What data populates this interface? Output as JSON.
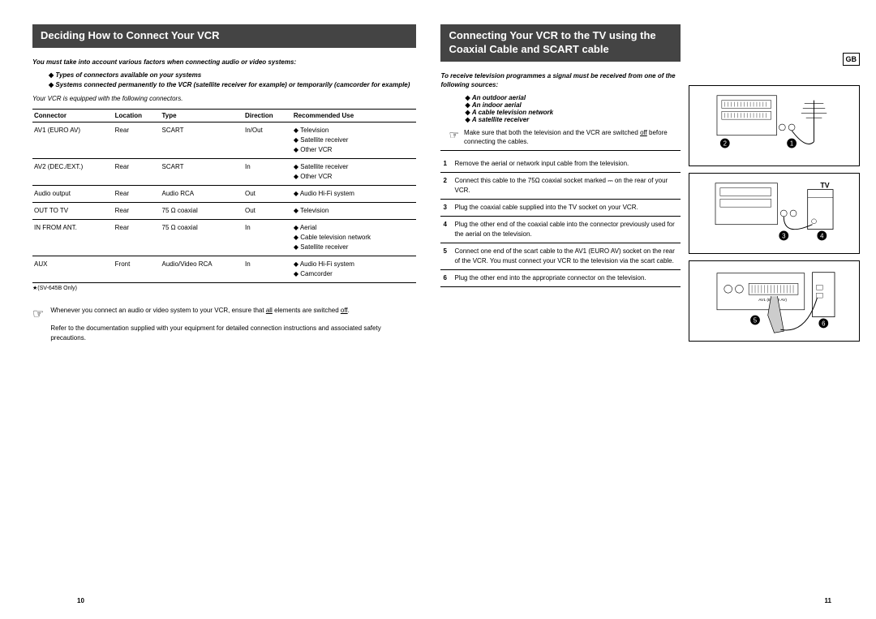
{
  "left": {
    "header": "Deciding How to Connect Your VCR",
    "intro": "You must take into account various factors when connecting audio or video systems:",
    "bullets": [
      "Types of connectors available on your systems",
      "Systems connected permanently to the VCR (satellite receiver for example) or temporarily (camcorder for example)"
    ],
    "subintro": "Your VCR is equipped with the following connectors.",
    "table": {
      "headers": [
        "Connector",
        "Location",
        "Type",
        "Direction",
        "Recommended Use"
      ],
      "rows": [
        {
          "connector": "AV1 (EURO AV)",
          "location": "Rear",
          "type": "SCART",
          "direction": "In/Out",
          "rec": [
            "Television",
            "Satellite receiver",
            "Other VCR"
          ]
        },
        {
          "connector": "AV2 (DEC./EXT.)",
          "location": "Rear",
          "type": "SCART",
          "direction": "In",
          "rec": [
            "Satellite receiver",
            "Other VCR"
          ]
        },
        {
          "connector": "Audio output",
          "location": "Rear",
          "type": "Audio RCA",
          "direction": "Out",
          "rec": [
            "Audio Hi-Fi system"
          ]
        },
        {
          "connector": "OUT TO TV",
          "location": "Rear",
          "type": "75 Ω coaxial",
          "direction": "Out",
          "rec": [
            "Television"
          ]
        },
        {
          "connector": "IN FROM ANT.",
          "location": "Rear",
          "type": "75 Ω coaxial",
          "direction": "In",
          "rec": [
            "Aerial",
            "Cable television network",
            "Satellite receiver"
          ]
        },
        {
          "connector": "AUX",
          "location": "Front",
          "type": "Audio/Video RCA",
          "direction": "In",
          "rec": [
            "Audio Hi-Fi system",
            "Camcorder"
          ]
        }
      ],
      "footnote": "★(SV-645B Only)"
    },
    "note1a": "Whenever you connect an audio or video system to your VCR, ensure that ",
    "note1_underline": "all",
    "note1b": " elements are switched ",
    "note1_underline2": "off",
    "note1c": ".",
    "note2": "Refer to the documentation supplied with your equipment for detailed connection instructions and associated safety precautions.",
    "page_num": "10"
  },
  "right": {
    "header": "Connecting Your VCR to the TV using the Coaxial Cable and SCART cable",
    "intro": "To receive television programmes a signal must be received from one of the following sources:",
    "sources": [
      "An outdoor aerial",
      "An indoor aerial",
      "A cable television network",
      "A satellite receiver"
    ],
    "hand_a": "Make sure that both the television and the VCR are switched ",
    "hand_under": "off",
    "hand_b": " before connecting the cables.",
    "steps": [
      "Remove the aerial or network input cable from the television.",
      "Connect this cable to the 75Ω coaxial socket marked ⎓ on the rear of your VCR.",
      "Plug the coaxial cable supplied into the TV socket on your VCR.",
      "Plug the other end of the coaxial cable into the connector previously used for the aerial on the television.",
      "Connect one end of the scart cable to the AV1 (EURO AV) socket on the rear of the VCR. You must connect your VCR to the television via the scart cable.",
      "Plug the other end into the appropriate connector on the television."
    ],
    "gb": "GB",
    "tv_label": "TV",
    "page_num": "11"
  }
}
